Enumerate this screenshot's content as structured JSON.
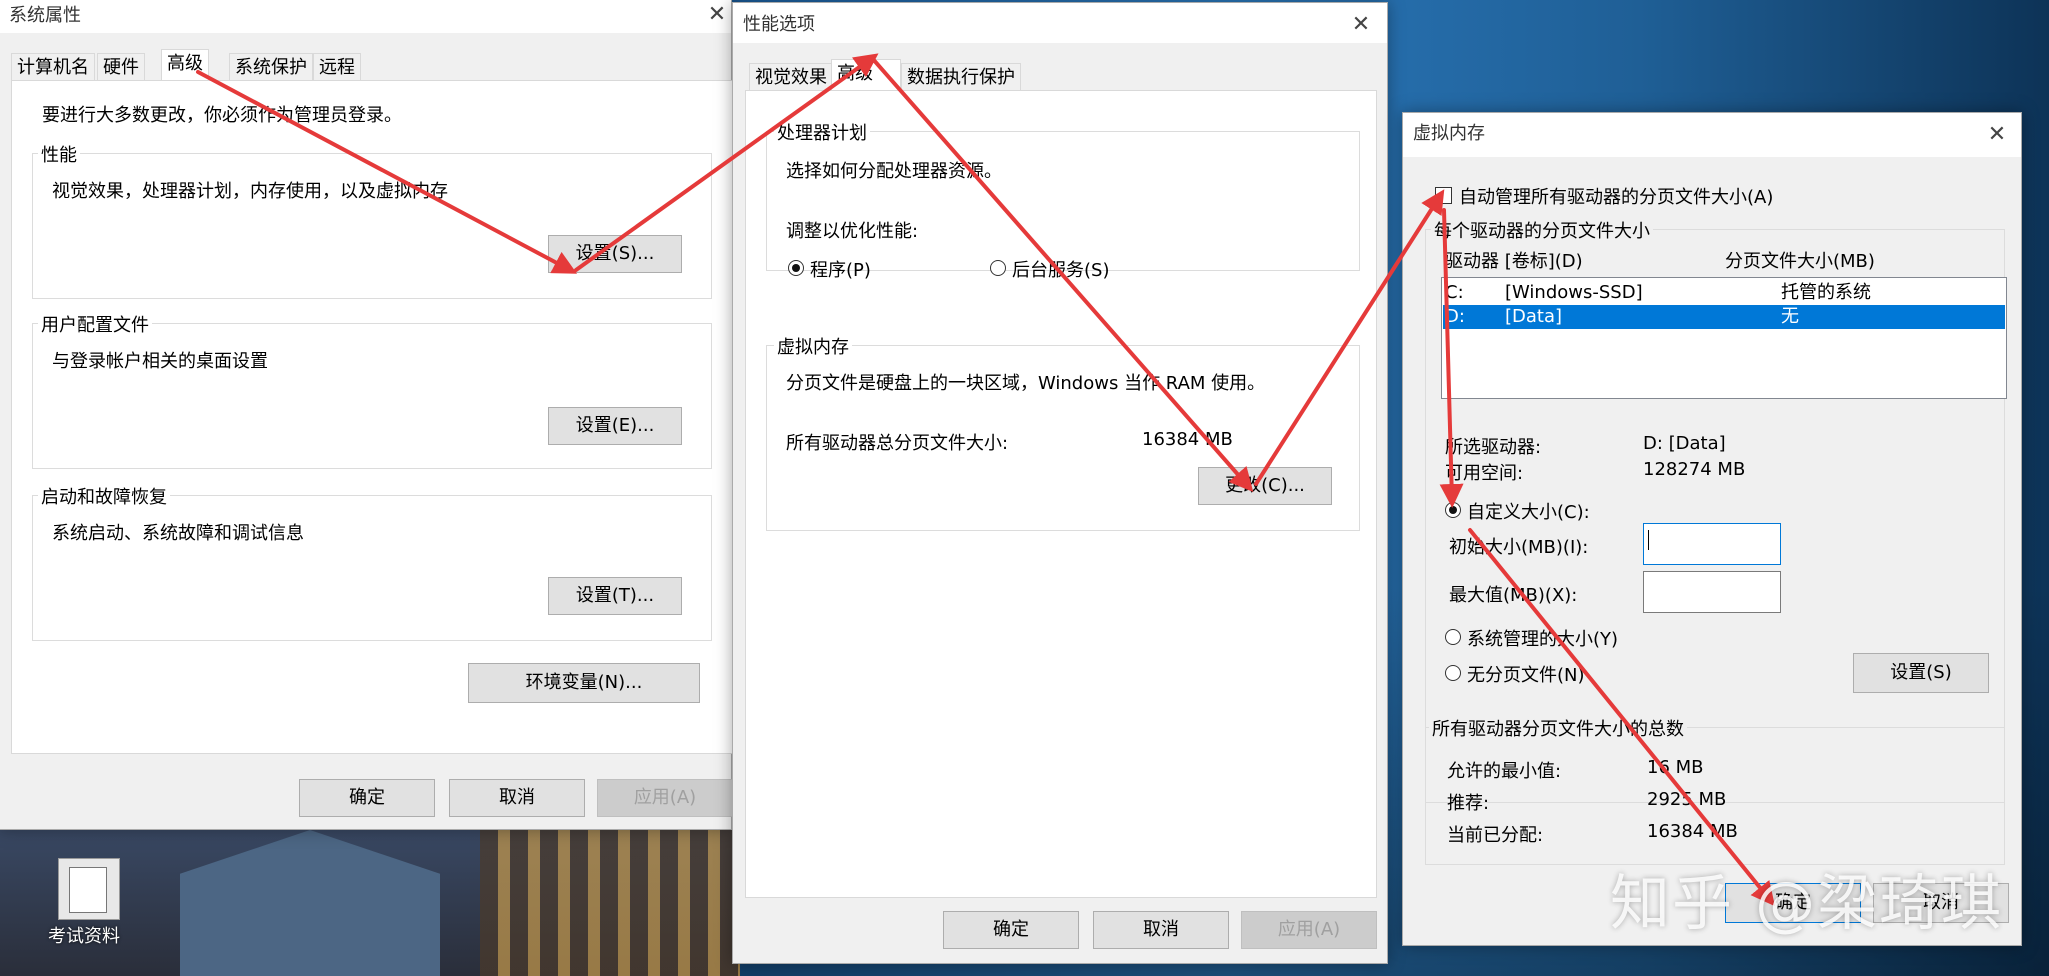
{
  "colors": {
    "selection": "#0078d7",
    "arrow": "#e53a3a",
    "dialog_bg": "#f0f0f0"
  },
  "desktop": {
    "icon_label": "考试资料",
    "watermark": "知乎 @梁琦琪"
  },
  "system_properties": {
    "title": "系统属性",
    "tabs": [
      "计算机名",
      "硬件",
      "高级",
      "系统保护",
      "远程"
    ],
    "admin_note": "要进行大多数更改，你必须作为管理员登录。",
    "performance": {
      "title": "性能",
      "desc": "视觉效果，处理器计划，内存使用，以及虚拟内存",
      "button": "设置(S)..."
    },
    "user_profiles": {
      "title": "用户配置文件",
      "desc": "与登录帐户相关的桌面设置",
      "button": "设置(E)..."
    },
    "startup": {
      "title": "启动和故障恢复",
      "desc": "系统启动、系统故障和调试信息",
      "button": "设置(T)..."
    },
    "env_button": "环境变量(N)...",
    "ok": "确定",
    "cancel": "取消",
    "apply": "应用(A)"
  },
  "performance_options": {
    "title": "性能选项",
    "tabs": [
      "视觉效果",
      "高级",
      "数据执行保护"
    ],
    "processor": {
      "title": "处理器计划",
      "desc": "选择如何分配处理器资源。",
      "adjust_label": "调整以优化性能:",
      "opt_programs": "程序(P)",
      "opt_services": "后台服务(S)"
    },
    "virtual_memory": {
      "title": "虚拟内存",
      "desc": "分页文件是硬盘上的一块区域，Windows 当作 RAM 使用。",
      "total_label": "所有驱动器总分页文件大小:",
      "total_value": "16384 MB",
      "change_button": "更改(C)..."
    },
    "ok": "确定",
    "cancel": "取消",
    "apply": "应用(A)"
  },
  "virtual_memory": {
    "title": "虚拟内存",
    "auto_manage": "自动管理所有驱动器的分页文件大小(A)",
    "per_drive_title": "每个驱动器的分页文件大小",
    "col_drive": "驱动器 [卷标](D)",
    "col_size": "分页文件大小(MB)",
    "drives": [
      {
        "drive": "C:",
        "label": "[Windows-SSD]",
        "size": "托管的系统"
      },
      {
        "drive": "D:",
        "label": "[Data]",
        "size": "无"
      }
    ],
    "selected_drive_label": "所选驱动器:",
    "selected_drive_value": "D:  [Data]",
    "free_space_label": "可用空间:",
    "free_space_value": "128274 MB",
    "custom_size": "自定义大小(C):",
    "initial_label": "初始大小(MB)(I):",
    "initial_value": "",
    "max_label": "最大值(MB)(X):",
    "max_value": "",
    "system_managed": "系统管理的大小(Y)",
    "no_paging": "无分页文件(N)",
    "set_button": "设置(S)",
    "totals_title": "所有驱动器分页文件大小的总数",
    "min_label": "允许的最小值:",
    "min_value": "16 MB",
    "rec_label": "推荐:",
    "rec_value": "2925 MB",
    "cur_label": "当前已分配:",
    "cur_value": "16384 MB",
    "ok": "确定",
    "cancel": "取消"
  }
}
